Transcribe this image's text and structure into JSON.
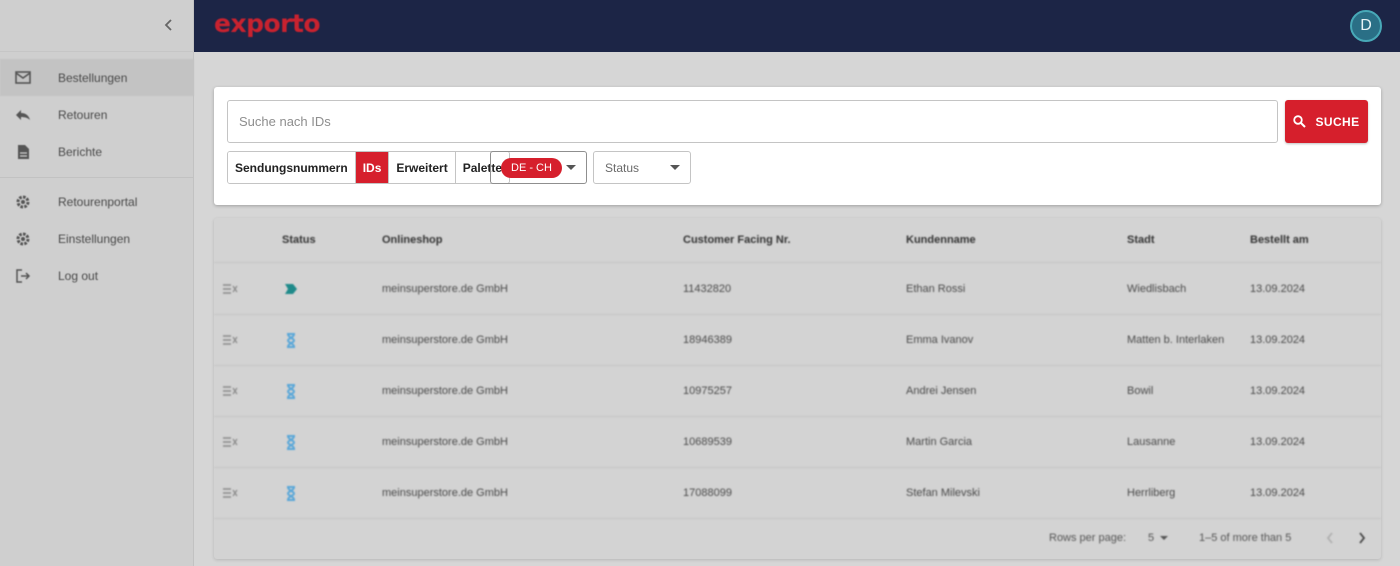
{
  "app": {
    "logo_text": "exporto",
    "avatar_initial": "D"
  },
  "sidebar": {
    "items": [
      {
        "label": "Bestellungen",
        "icon": "mail-icon",
        "active": true
      },
      {
        "label": "Retouren",
        "icon": "reply-icon"
      },
      {
        "label": "Berichte",
        "icon": "document-icon"
      },
      {
        "label": "Retourenportal",
        "icon": "gear-icon"
      },
      {
        "label": "Einstellungen",
        "icon": "gear-icon"
      },
      {
        "label": "Log out",
        "icon": "logout-icon"
      }
    ]
  },
  "search": {
    "placeholder": "Suche nach IDs",
    "value": "",
    "button_label": "SUCHE",
    "toggles": [
      "Sendungsnummern",
      "IDs",
      "Erweitert",
      "Palette"
    ],
    "active_toggle": "IDs",
    "country_chip": "DE - CH",
    "status_label": "Status"
  },
  "table": {
    "headers": [
      "Status",
      "Onlineshop",
      "Customer Facing Nr.",
      "Kundenname",
      "Stadt",
      "Bestellt am"
    ],
    "rows": [
      {
        "status_icon": "shipped-tag-icon",
        "shop": "meinsuperstore.de GmbH",
        "nr": "11432820",
        "customer": "Ethan Rossi",
        "city": "Wiedlisbach",
        "date": "13.09.2024"
      },
      {
        "status_icon": "hourglass-icon",
        "shop": "meinsuperstore.de GmbH",
        "nr": "18946389",
        "customer": "Emma Ivanov",
        "city": "Matten b. Interlaken",
        "date": "13.09.2024"
      },
      {
        "status_icon": "hourglass-icon",
        "shop": "meinsuperstore.de GmbH",
        "nr": "10975257",
        "customer": "Andrei Jensen",
        "city": "Bowil",
        "date": "13.09.2024"
      },
      {
        "status_icon": "hourglass-icon",
        "shop": "meinsuperstore.de GmbH",
        "nr": "10689539",
        "customer": "Martin Garcia",
        "city": "Lausanne",
        "date": "13.09.2024"
      },
      {
        "status_icon": "hourglass-icon",
        "shop": "meinsuperstore.de GmbH",
        "nr": "17088099",
        "customer": "Stefan Milevski",
        "city": "Herrliberg",
        "date": "13.09.2024"
      }
    ]
  },
  "pagination": {
    "rows_per_page_label": "Rows per page:",
    "rows_per_page_value": "5",
    "range_text": "1–5 of more than 5"
  },
  "colors": {
    "brand_red": "#d61f2c",
    "header_navy": "#1c2546",
    "status_teal": "#1f8a8a",
    "status_blue": "#5aa7d8"
  }
}
